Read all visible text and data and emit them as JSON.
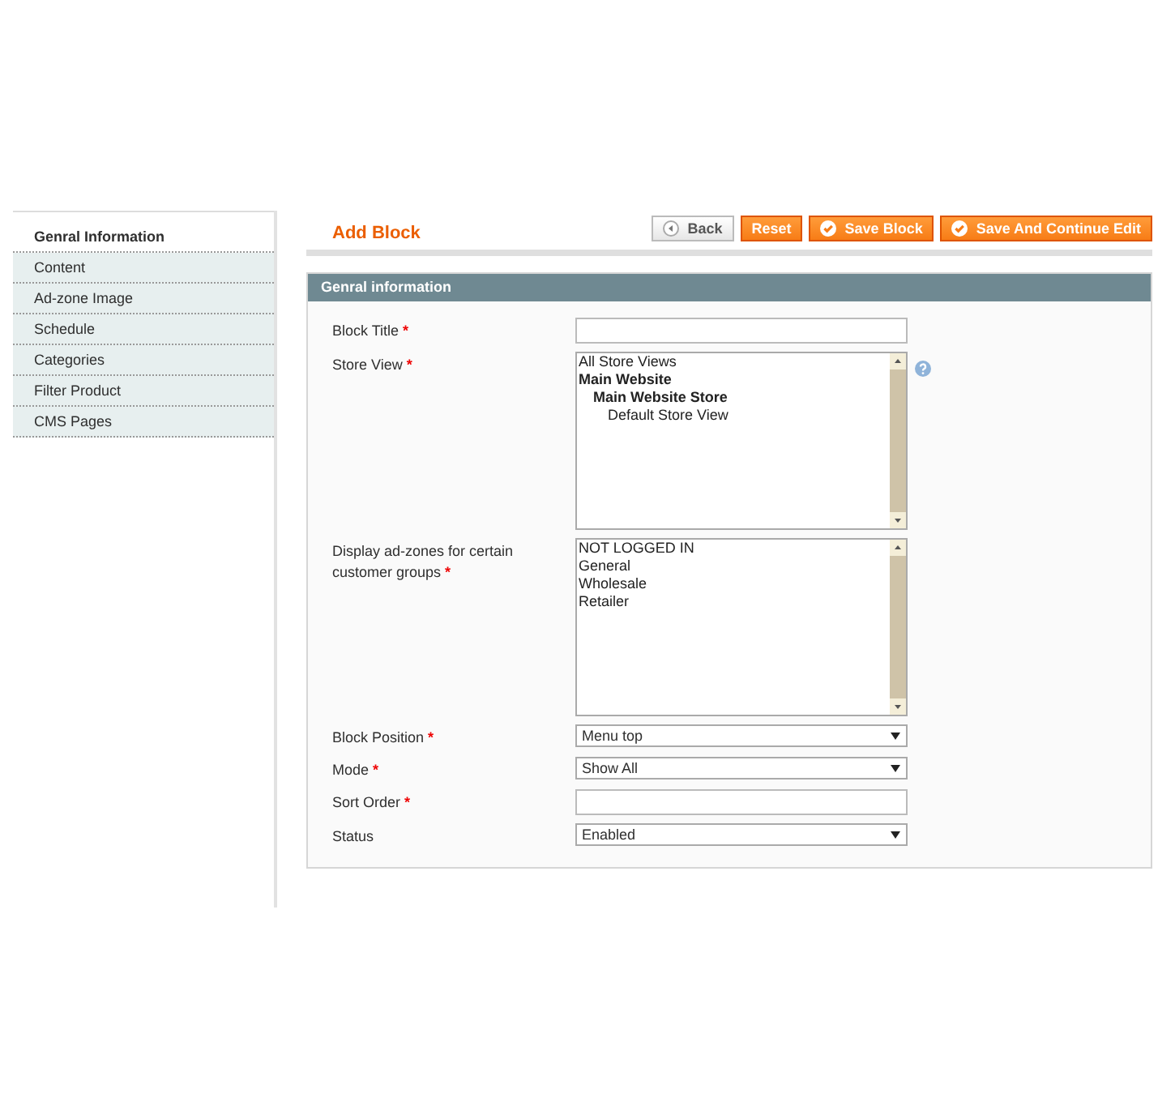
{
  "sidebar": {
    "items": [
      {
        "label": "Genral Information",
        "selected": true
      },
      {
        "label": "Content",
        "selected": false
      },
      {
        "label": "Ad-zone Image",
        "selected": false
      },
      {
        "label": "Schedule",
        "selected": false
      },
      {
        "label": "Categories",
        "selected": false
      },
      {
        "label": "Filter Product",
        "selected": false
      },
      {
        "label": "CMS Pages",
        "selected": false
      }
    ]
  },
  "page_title": "Add Block",
  "buttons": [
    {
      "label": "Back",
      "kind": "back"
    },
    {
      "label": "Reset",
      "kind": "reset"
    },
    {
      "label": "Save Block",
      "kind": "save"
    },
    {
      "label": "Save And Continue Edit",
      "kind": "save"
    }
  ],
  "section_title": "Genral information",
  "fields": [
    {
      "label": "Block Title",
      "required_mark": "*",
      "kind": "text"
    },
    {
      "label": "Store View",
      "required_mark": "*",
      "kind": "multiselect",
      "help": true,
      "options": [
        {
          "label": "All Store Views"
        },
        {
          "label": "Main Website",
          "children": [
            {
              "label": "Main Website Store",
              "children": [
                {
                  "label": "Default Store View"
                }
              ]
            }
          ]
        }
      ]
    },
    {
      "label": "Display ad-zones for certain customer groups",
      "required_mark": "*",
      "kind": "multiselect",
      "options": [
        {
          "label": "NOT LOGGED IN"
        },
        {
          "label": "General"
        },
        {
          "label": "Wholesale"
        },
        {
          "label": "Retailer"
        }
      ]
    },
    {
      "label": "Block Position",
      "required_mark": "*",
      "kind": "select",
      "value": "Menu top"
    },
    {
      "label": "Mode",
      "required_mark": "*",
      "kind": "select",
      "value": "Show All"
    },
    {
      "label": "Sort Order",
      "required_mark": "*",
      "kind": "text"
    },
    {
      "label": "Status",
      "kind": "select",
      "value": "Enabled"
    }
  ]
}
